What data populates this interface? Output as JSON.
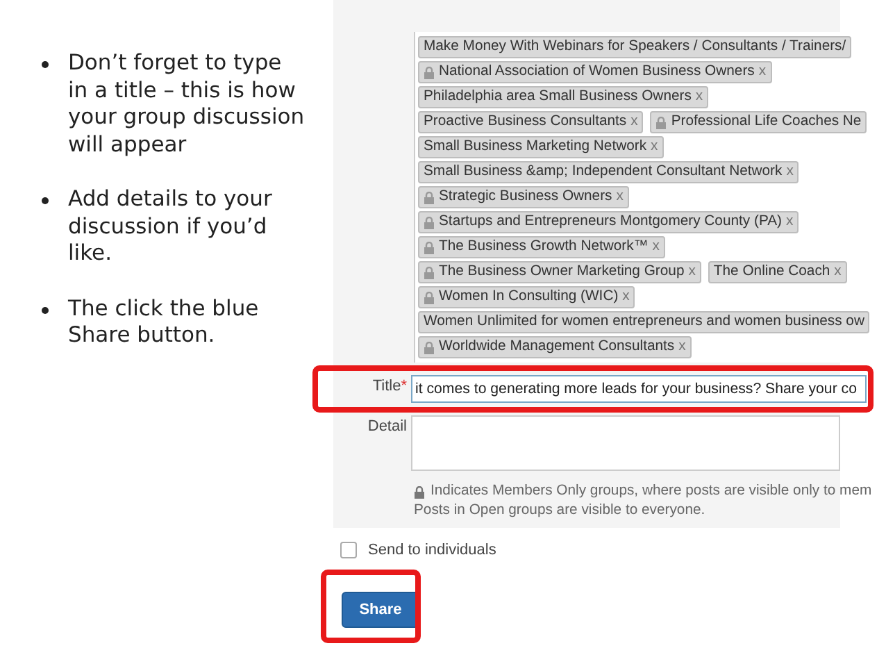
{
  "bullets": [
    "Don’t forget to type in a title – this is how your group discussion will appear",
    "Add details to your discussion if you’d like.",
    "The click the blue Share button."
  ],
  "groups": [
    [
      {
        "name": "Make Money With Webinars for Speakers / Consultants / Trainers/",
        "locked": false
      }
    ],
    [
      {
        "name": "National Association of Women Business Owners",
        "locked": true,
        "remove": "x"
      }
    ],
    [
      {
        "name": "Philadelphia area Small Business Owners",
        "locked": false,
        "remove": "x"
      }
    ],
    [
      {
        "name": "Proactive Business Consultants",
        "locked": false,
        "remove": "x"
      },
      {
        "name": "Professional Life Coaches Ne",
        "locked": true
      }
    ],
    [
      {
        "name": "Small Business Marketing Network",
        "locked": false,
        "remove": "x"
      }
    ],
    [
      {
        "name": "Small Business &amp; Independent Consultant Network",
        "locked": false,
        "remove": "x"
      }
    ],
    [
      {
        "name": "Strategic Business Owners",
        "locked": true,
        "remove": "x"
      }
    ],
    [
      {
        "name": "Startups and Entrepreneurs Montgomery County (PA)",
        "locked": true,
        "remove": "x"
      }
    ],
    [
      {
        "name": "The Business Growth Network™",
        "locked": true,
        "remove": "x"
      }
    ],
    [
      {
        "name": "The Business Owner Marketing Group",
        "locked": true,
        "remove": "x"
      },
      {
        "name": "The Online Coach",
        "locked": false,
        "remove": "x"
      }
    ],
    [
      {
        "name": "Women In Consulting (WIC)",
        "locked": true,
        "remove": "x"
      }
    ],
    [
      {
        "name": "Women Unlimited for women entrepreneurs and women business ow",
        "locked": false
      }
    ],
    [
      {
        "name": "Worldwide Management Consultants",
        "locked": true,
        "remove": "x"
      }
    ]
  ],
  "title_field": {
    "label": "Title",
    "required_mark": "*",
    "value": "it comes to generating more leads for your business? Share your co"
  },
  "detail_field": {
    "label": "Detail"
  },
  "notes": [
    "Indicates Members Only groups, where posts are visible only to mem",
    "Posts in Open groups are visible to everyone."
  ],
  "send_to_individuals": {
    "label": "Send to individuals",
    "checked": false
  },
  "share_button": "Share"
}
